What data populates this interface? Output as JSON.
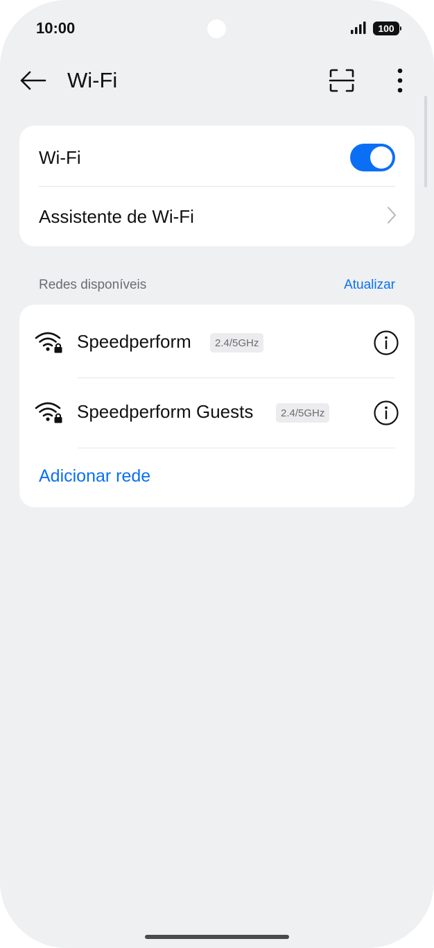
{
  "status_bar": {
    "time": "10:00",
    "battery": "100",
    "icons": [
      "signal-icon",
      "battery-icon"
    ]
  },
  "header": {
    "title": "Wi-Fi",
    "icons": [
      "back-arrow-icon",
      "qr-scan-icon",
      "more-vert-icon"
    ]
  },
  "wifi_card": {
    "wifi_label": "Wi-Fi",
    "wifi_enabled": true,
    "assistant_label": "Assistente de Wi-Fi"
  },
  "networks_section": {
    "title": "Redes disponíveis",
    "refresh_label": "Atualizar",
    "networks": [
      {
        "name": "Speedperform",
        "band": "2.4/5GHz",
        "icon": "wifi-lock-icon"
      },
      {
        "name": "Speedperform Guests",
        "band": "2.4/5GHz",
        "icon": "wifi-lock-icon"
      }
    ],
    "add_network_label": "Adicionar rede"
  },
  "colors": {
    "accent": "#0a6ff5",
    "background": "#eff0f2",
    "card": "#ffffff"
  }
}
